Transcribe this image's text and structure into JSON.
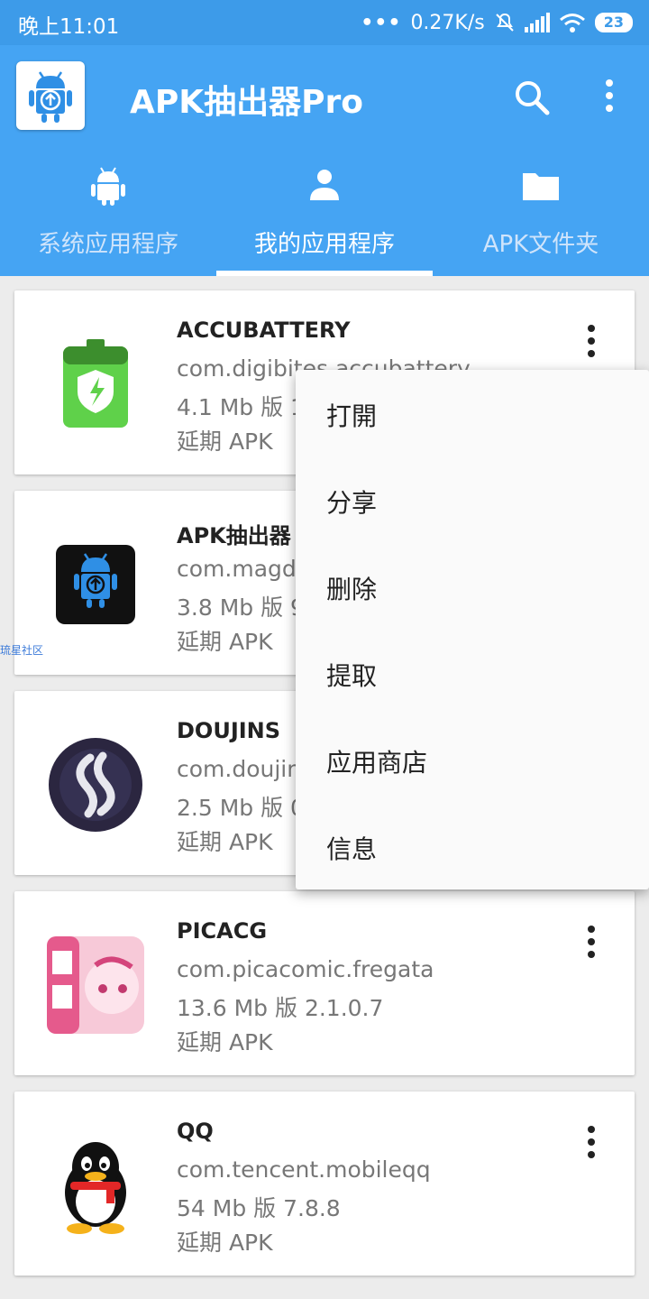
{
  "status_bar": {
    "time": "晚上11:01",
    "speed": "0.27K/s",
    "battery": "23"
  },
  "app_bar": {
    "title": "APK抽出器Pro"
  },
  "tabs": [
    {
      "label": "系统应用程序",
      "icon": "android-icon"
    },
    {
      "label": "我的应用程序",
      "icon": "person-icon"
    },
    {
      "label": "APK文件夹",
      "icon": "folder-icon"
    }
  ],
  "active_tab": "我的应用程序",
  "apps": [
    {
      "name": "ACCUBATTERY",
      "package": "com.digibites.accubattery",
      "size_version": "4.1 Mb 版 1",
      "status": "延期 APK"
    },
    {
      "name": "APK抽出器",
      "package": "com.magd",
      "size_version": "3.8 Mb 版 9",
      "status": "延期 APK"
    },
    {
      "name": "DOUJINS",
      "package": "com.doujin",
      "size_version": "2.5 Mb 版 0",
      "status": "延期 APK"
    },
    {
      "name": "PICACG",
      "package": "com.picacomic.fregata",
      "size_version": "13.6 Mb 版 2.1.0.7",
      "status": "延期 APK"
    },
    {
      "name": "QQ",
      "package": "com.tencent.mobileqq",
      "size_version": "54 Mb 版 7.8.8",
      "status": "延期 APK"
    }
  ],
  "watermark": "琉星社区",
  "context_menu": [
    "打開",
    "分享",
    "删除",
    "提取",
    "应用商店",
    "信息"
  ],
  "colors": {
    "primary": "#45a4f3",
    "status_bar": "#3d9be9",
    "battery_icon": "#5fd14a"
  }
}
